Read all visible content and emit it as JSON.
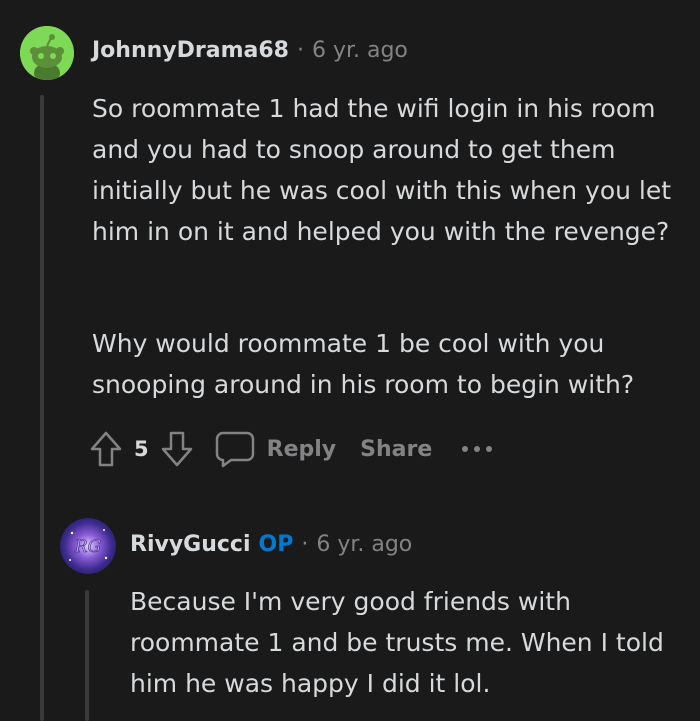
{
  "comment1": {
    "username": "JohnnyDrama68",
    "separator": "·",
    "time": "6 yr. ago",
    "avatar": "snoo-avatar",
    "paragraphs": [
      "So roommate 1 had the wifi login in his room and you had to snoop around to get them initially but he was cool with this when you let him in on it and helped you with the revenge?",
      "Why would roommate 1 be cool with you snooping around in his room to begin with?"
    ],
    "votes": "5",
    "reply_label": "Reply",
    "share_label": "Share",
    "more_icon": "more-options-icon"
  },
  "comment2": {
    "username": "RivyGucci",
    "op_badge": "OP",
    "separator": "·",
    "time": "6 yr. ago",
    "avatar": "rg-avatar",
    "avatar_text": "RG",
    "paragraphs": [
      "Because I'm very good friends with roommate 1 and be trusts me. When I told him he was happy I did it lol."
    ]
  },
  "colors": {
    "background": "#1a1a1b",
    "text": "#d7dadc",
    "muted": "#818384",
    "op": "#0079d3",
    "snoo_bg": "#7ed957"
  }
}
